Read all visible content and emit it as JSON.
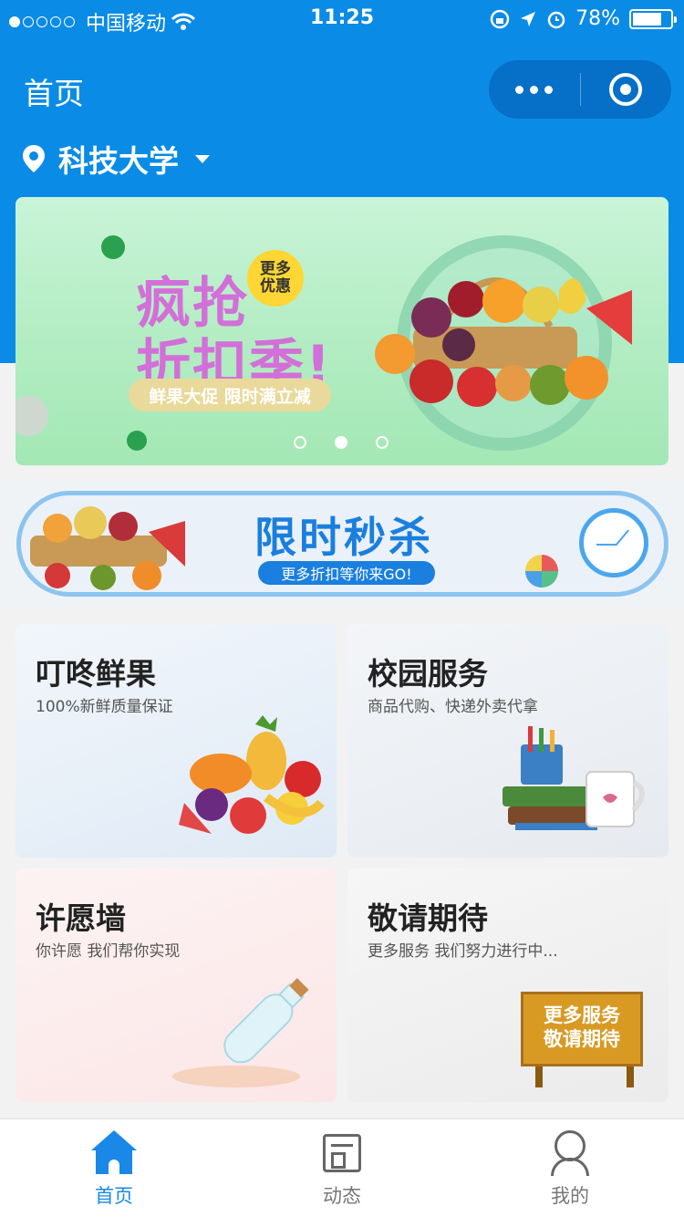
{
  "status_bar": {
    "carrier": "中国移动",
    "time": "11:25",
    "battery": "78%"
  },
  "nav": {
    "title": "首页"
  },
  "location": {
    "name": "科技大学"
  },
  "banner": {
    "title_line1": "疯抢",
    "title_line2": "折扣季!",
    "badge": "更多优惠",
    "pill": "鲜果大促 限时满立减",
    "active_index": 1
  },
  "seckill": {
    "title": "限时秒杀",
    "subtitle": "更多折扣等你来GO!"
  },
  "cards": [
    {
      "title": "叮咚鲜果",
      "subtitle": "100%新鲜质量保证"
    },
    {
      "title": "校园服务",
      "subtitle": "商品代购、快递外卖代拿"
    },
    {
      "title": "许愿墙",
      "subtitle": "你许愿 我们帮你实现"
    },
    {
      "title": "敬请期待",
      "subtitle": "更多服务 我们努力进行中...",
      "sign_line1": "更多服务",
      "sign_line2": "敬请期待"
    }
  ],
  "tabbar": {
    "items": [
      {
        "label": "首页",
        "active": true
      },
      {
        "label": "动态",
        "active": false
      },
      {
        "label": "我的",
        "active": false
      }
    ],
    "active_color": "#1a88e6"
  },
  "colors": {
    "primary": "#0a8be6",
    "banner_title": "#d36fd8",
    "seckill_blue": "#1a7fde"
  }
}
